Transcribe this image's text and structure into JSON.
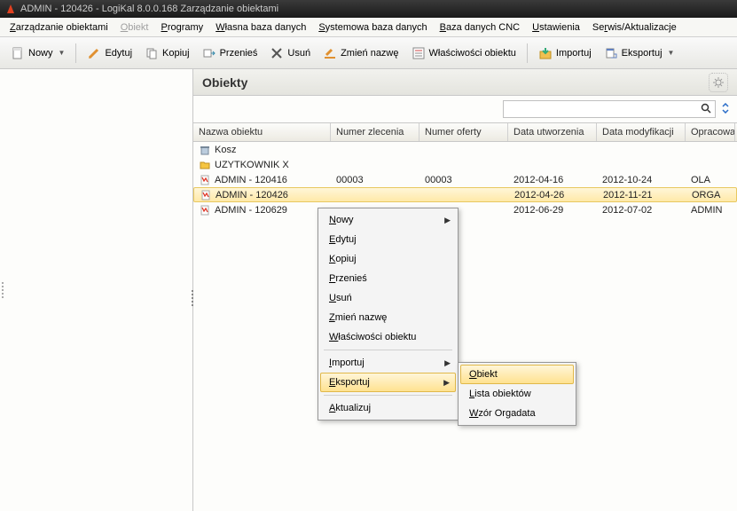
{
  "window": {
    "title": "ADMIN - 120426 - LogiKal 8.0.0.168 Zarządzanie obiektami"
  },
  "menubar": [
    {
      "label": "Zarządzanie obiektami",
      "u": 0,
      "disabled": false
    },
    {
      "label": "Obiekt",
      "u": 0,
      "disabled": true
    },
    {
      "label": "Programy",
      "u": 0,
      "disabled": false
    },
    {
      "label": "Własna baza danych",
      "u": 0,
      "disabled": false
    },
    {
      "label": "Systemowa baza danych",
      "u": 0,
      "disabled": false
    },
    {
      "label": "Baza danych CNC",
      "u": 0,
      "disabled": false
    },
    {
      "label": "Ustawienia",
      "u": 0,
      "disabled": false
    },
    {
      "label": "Serwis/Aktualizacje",
      "u": 2,
      "disabled": false
    }
  ],
  "toolbar": {
    "new": "Nowy",
    "edit": "Edytuj",
    "copy": "Kopiuj",
    "move": "Przenieś",
    "delete": "Usuń",
    "rename": "Zmień nazwę",
    "props": "Właściwości obiektu",
    "import": "Importuj",
    "export": "Eksportuj"
  },
  "panel": {
    "title": "Obiekty"
  },
  "search": {
    "value": ""
  },
  "columns": {
    "name": "Nazwa obiektu",
    "order": "Numer zlecenia",
    "offer": "Numer oferty",
    "created": "Data utworzenia",
    "modified": "Data modyfikacji",
    "author": "Opracowa"
  },
  "rows": [
    {
      "type": "trash",
      "name": "Kosz",
      "order": "",
      "offer": "",
      "created": "",
      "modified": "",
      "author": ""
    },
    {
      "type": "folder",
      "name": "UZYTKOWNIK X",
      "order": "",
      "offer": "",
      "created": "",
      "modified": "",
      "author": ""
    },
    {
      "type": "proj",
      "name": "ADMIN - 120416",
      "order": "00003",
      "offer": "00003",
      "created": "2012-04-16",
      "modified": "2012-10-24",
      "author": "OLA"
    },
    {
      "type": "proj",
      "name": "ADMIN - 120426",
      "order": "",
      "offer": "",
      "created": "2012-04-26",
      "modified": "2012-11-21",
      "author": "ORGA",
      "selected": true
    },
    {
      "type": "proj",
      "name": "ADMIN - 120629",
      "order": "",
      "offer": "",
      "created": "2012-06-29",
      "modified": "2012-07-02",
      "author": "ADMIN"
    }
  ],
  "context_menu": [
    {
      "label": "Nowy",
      "u": 0,
      "sub": true
    },
    {
      "label": "Edytuj",
      "u": 0
    },
    {
      "label": "Kopiuj",
      "u": 0
    },
    {
      "label": "Przenieś",
      "u": 0
    },
    {
      "label": "Usuń",
      "u": 0
    },
    {
      "label": "Zmień nazwę",
      "u": 0
    },
    {
      "label": "Właściwości obiektu",
      "u": 0
    },
    {
      "sep": true
    },
    {
      "label": "Importuj",
      "u": 0,
      "sub": true
    },
    {
      "label": "Eksportuj",
      "u": 0,
      "sub": true,
      "highlight": true
    },
    {
      "sep": true
    },
    {
      "label": "Aktualizuj",
      "u": 0
    }
  ],
  "sub_menu": [
    {
      "label": "Obiekt",
      "u": 0,
      "highlight": true
    },
    {
      "label": "Lista obiektów",
      "u": 0
    },
    {
      "label": "Wzór Orgadata",
      "u": 0
    }
  ]
}
